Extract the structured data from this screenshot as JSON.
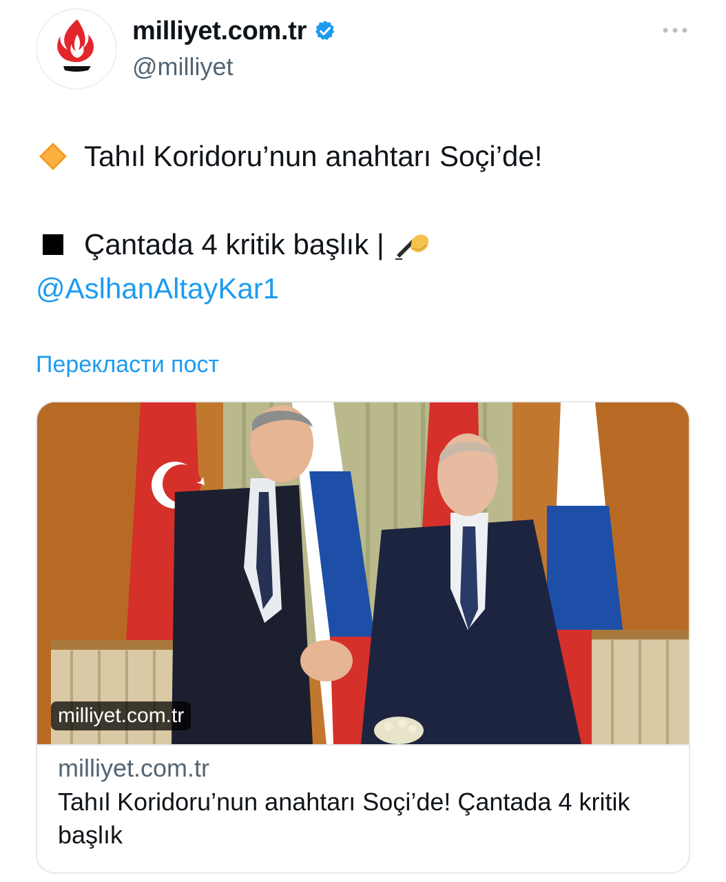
{
  "author": {
    "name": "milliyet.com.tr",
    "handle": "@milliyet",
    "verified": true,
    "avatar_icon": "milliyet-flame-logo",
    "verified_icon": "verified-badge-icon"
  },
  "menu": {
    "more_icon": "more-options-icon"
  },
  "tweet": {
    "line1_emoji": "orange-diamond-emoji",
    "line1_text": "Tahıl Koridoru’nun anahtarı Soçi’de!",
    "line2_emoji": "black-square-emoji",
    "line2_text": "Çantada 4 kritik başlık |",
    "line2_trailing_emoji": "writing-hand-emoji",
    "mention": "@AslhanAltayKar1"
  },
  "translate": {
    "label": "Перекласти пост"
  },
  "card": {
    "image_badge": "milliyet.com.tr",
    "domain": "milliyet.com.tr",
    "title": "Tahıl Koridoru’nun anahtarı Soçi’de! Çantada 4 kritik başlık"
  },
  "colors": {
    "link": "#1d9bf0",
    "text": "#0f1419",
    "secondary": "#536471",
    "border": "#e6e8ea"
  }
}
